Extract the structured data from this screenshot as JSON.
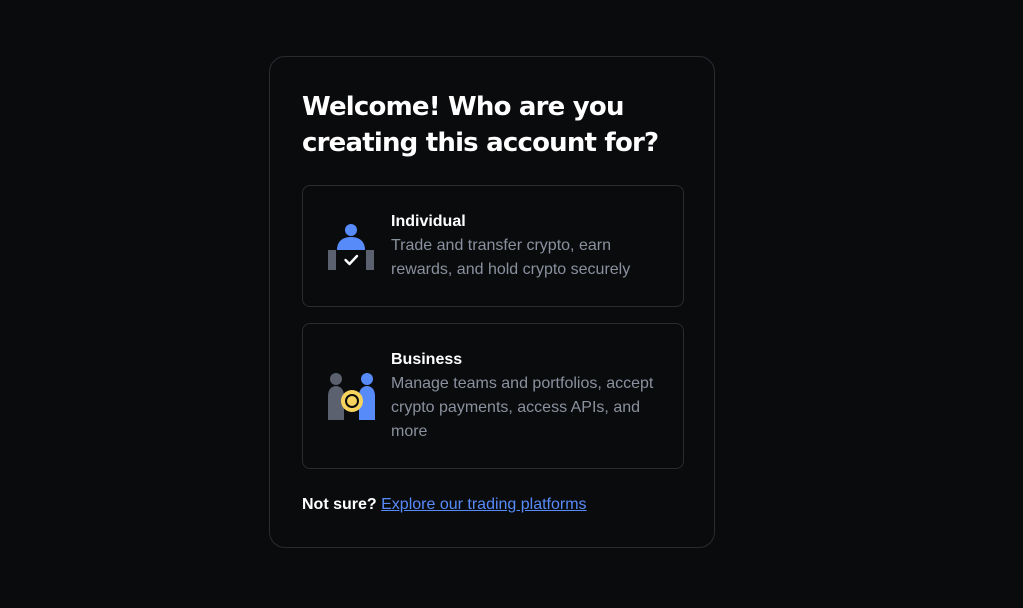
{
  "heading": "Welcome! Who are you creating this account for?",
  "options": [
    {
      "title": "Individual",
      "description": "Trade and transfer crypto, earn rewards, and hold crypto securely",
      "icon": "individual-person-icon"
    },
    {
      "title": "Business",
      "description": "Manage teams and portfolios, accept crypto payments, access APIs, and more",
      "icon": "business-team-icon"
    }
  ],
  "footer": {
    "prompt": "Not sure?",
    "link_label": "Explore our trading platforms"
  },
  "colors": {
    "background": "#0a0b0d",
    "border": "#2a2c31",
    "text_secondary": "#8a919e",
    "link": "#578bfa",
    "icon_blue": "#578bfa",
    "icon_yellow": "#f8d35d",
    "icon_gray": "#5b616e"
  }
}
